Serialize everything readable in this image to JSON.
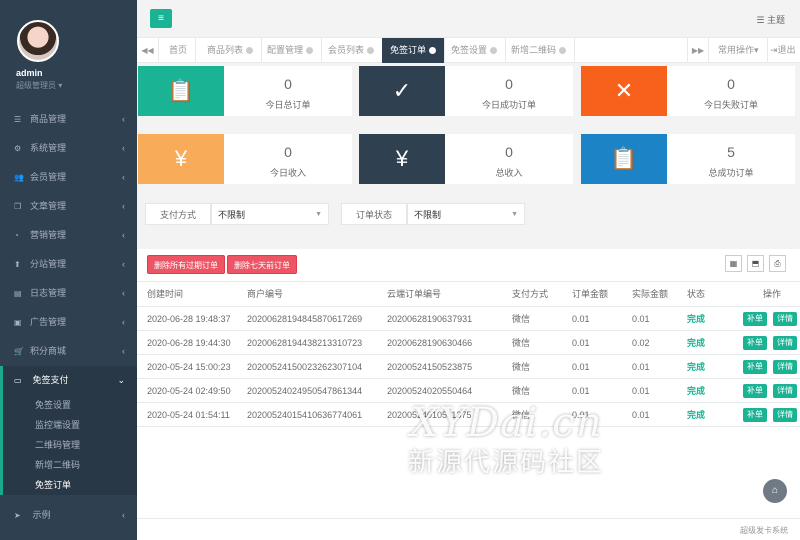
{
  "sidebar": {
    "user_name": "admin",
    "user_role": "超级管理员 ▾",
    "items": [
      {
        "label": "商品管理",
        "icon": "list-icon"
      },
      {
        "label": "系统管理",
        "icon": "gear-icon"
      },
      {
        "label": "会员管理",
        "icon": "users-icon"
      },
      {
        "label": "文章管理",
        "icon": "copy-icon"
      },
      {
        "label": "营销管理",
        "icon": "pie-icon"
      },
      {
        "label": "分站管理",
        "icon": "pin-icon"
      },
      {
        "label": "日志管理",
        "icon": "calendar-icon"
      },
      {
        "label": "广告管理",
        "icon": "image-icon"
      },
      {
        "label": "积分商城",
        "icon": "cart-icon"
      }
    ],
    "active_group": {
      "label": "免签支付",
      "icon": "card-icon"
    },
    "subitems": [
      "免签设置",
      "监控端设置",
      "二维码管理",
      "新增二维码",
      "免签订单"
    ],
    "last_item": {
      "label": "示例",
      "icon": "send-icon"
    }
  },
  "topbar": {
    "theme_label": "主题"
  },
  "tabs": {
    "items": [
      "首页",
      "商品列表",
      "配置管理",
      "会员列表",
      "免签订单",
      "免签设置",
      "新增二维码"
    ],
    "active": "免签订单",
    "common_ops": "常用操作▾",
    "logout": "退出"
  },
  "stats": [
    {
      "value": "0",
      "label": "今日总订单",
      "color": "#1ab394",
      "icon": "clipboard-icon"
    },
    {
      "value": "0",
      "label": "今日成功订单",
      "color": "#2f4050",
      "icon": "check-icon"
    },
    {
      "value": "0",
      "label": "今日失败订单",
      "color": "#f8611c",
      "icon": "cross-icon"
    },
    {
      "value": "0",
      "label": "今日收入",
      "color": "#f8ac59",
      "icon": "yen-icon"
    },
    {
      "value": "0",
      "label": "总收入",
      "color": "#2f4050",
      "icon": "yen-icon"
    },
    {
      "value": "5",
      "label": "总成功订单",
      "color": "#1c84c6",
      "icon": "clipboard-icon"
    }
  ],
  "filters": {
    "pay_method_label": "支付方式",
    "pay_method_value": "不限制",
    "order_status_label": "订单状态",
    "order_status_value": "不限制"
  },
  "actions": {
    "delete_expired": "删除所有过期订单",
    "delete_7days": "删除七天前订单"
  },
  "table": {
    "headers": [
      "创建时间",
      "商户编号",
      "云端订单编号",
      "支付方式",
      "订单金额",
      "实际金额",
      "状态",
      "操作"
    ],
    "rows": [
      {
        "time": "2020-06-28 19:48:37",
        "merchant": "20200628194845870617269",
        "cloud": "20200628190637931",
        "pay": "微信",
        "amount": "0.01",
        "actual": "0.01",
        "status": "完成"
      },
      {
        "time": "2020-06-28 19:44:30",
        "merchant": "20200628194438213310723",
        "cloud": "20200628190630466",
        "pay": "微信",
        "amount": "0.01",
        "actual": "0.02",
        "status": "完成"
      },
      {
        "time": "2020-05-24 15:00:23",
        "merchant": "20200524150023262307104",
        "cloud": "20200524150523875",
        "pay": "微信",
        "amount": "0.01",
        "actual": "0.01",
        "status": "完成"
      },
      {
        "time": "2020-05-24 02:49:50",
        "merchant": "20200524024950547861344",
        "cloud": "20200524020550464",
        "pay": "微信",
        "amount": "0.01",
        "actual": "0.01",
        "status": "完成"
      },
      {
        "time": "2020-05-24 01:54:11",
        "merchant": "20200524015410636774061",
        "cloud": "20200524010511375",
        "pay": "微信",
        "amount": "0.01",
        "actual": "0.01",
        "status": "完成"
      }
    ],
    "btn_fix": "补单",
    "btn_detail": "详情"
  },
  "footer": {
    "text": "超级发卡系统"
  },
  "watermark": {
    "line1": "XYDai.cn",
    "line2": "新源代源码社区"
  }
}
